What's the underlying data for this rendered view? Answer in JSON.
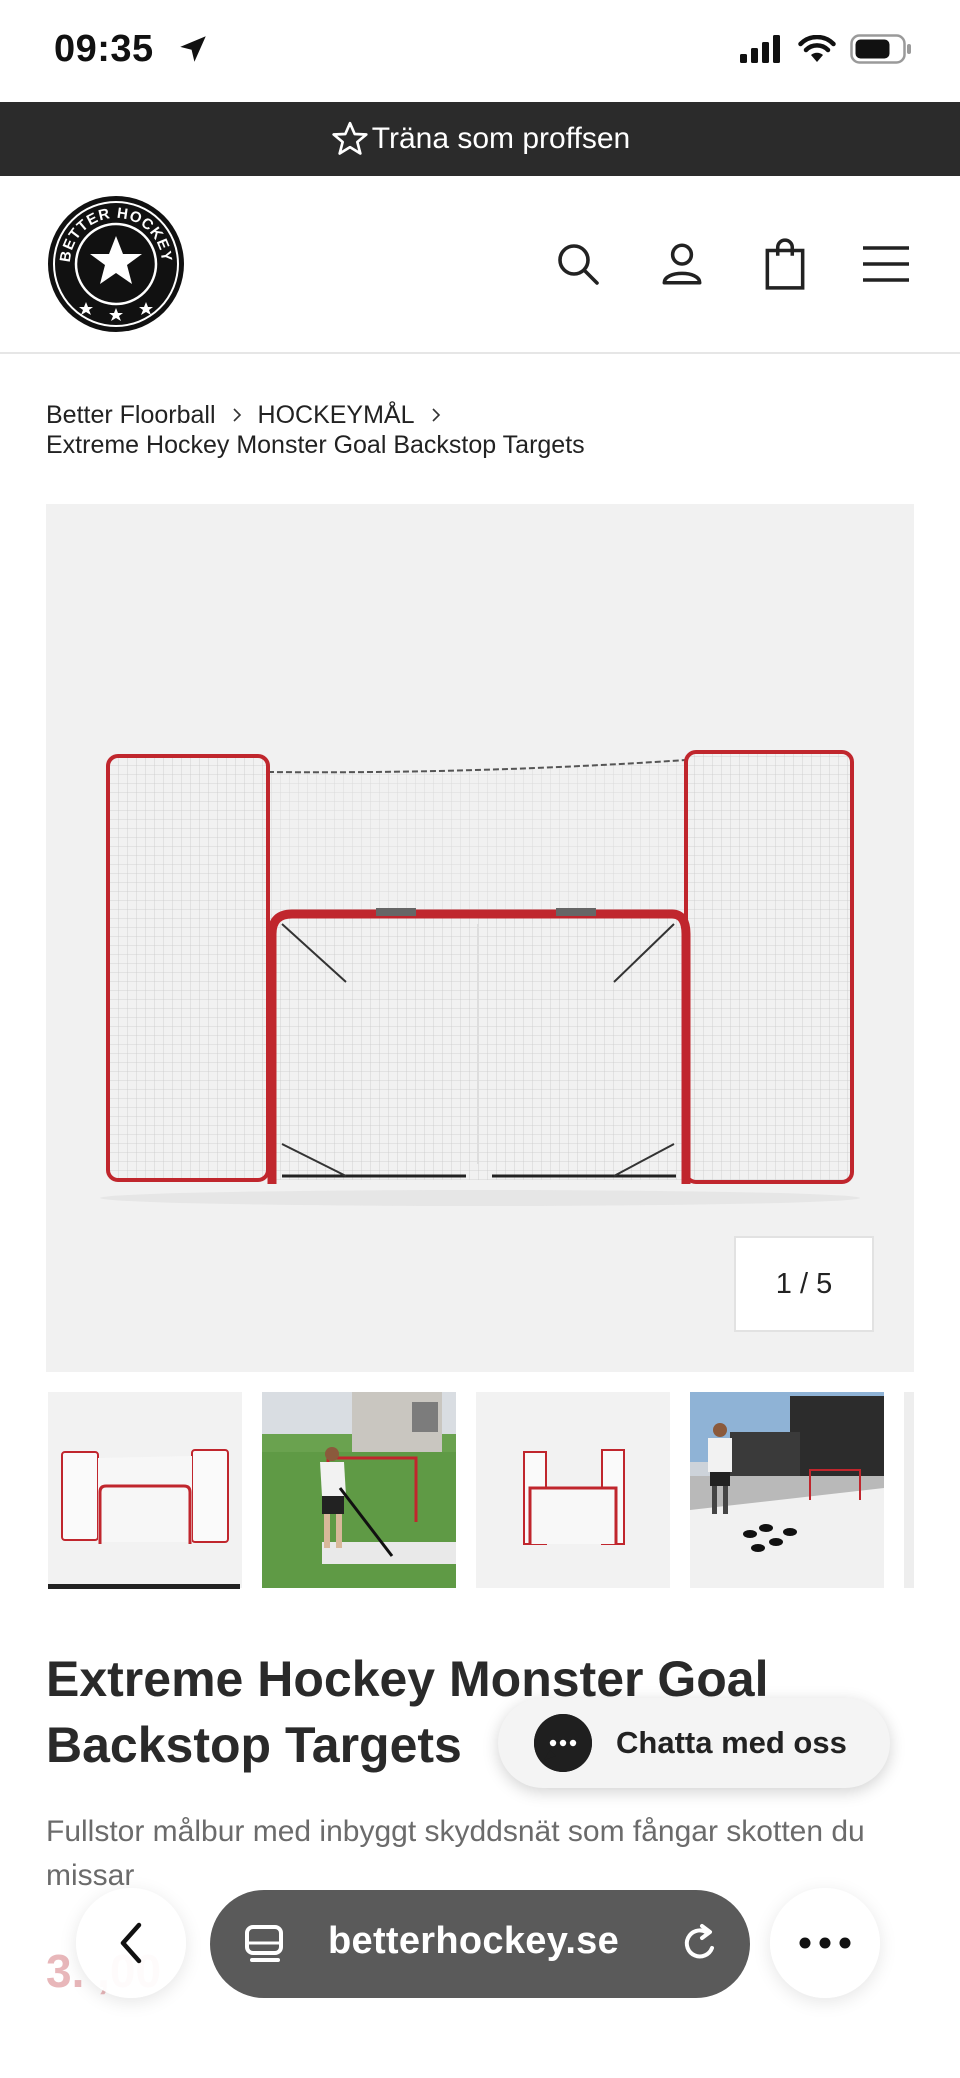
{
  "status_bar": {
    "time": "09:35"
  },
  "announcement": {
    "text": "Träna som proffsen"
  },
  "header": {
    "logo_text": "BETTER HOCKEY"
  },
  "breadcrumb": {
    "items": [
      "Better Floorball",
      "HOCKEYMÅL"
    ],
    "current": "Extreme Hockey Monster Goal Backstop Targets"
  },
  "gallery": {
    "counter": "1 / 5"
  },
  "product": {
    "title": "Extreme Hockey Monster Goal Backstop Targets",
    "subtitle": "Fullstor målbur med inbyggt skyddsnät som fångar skotten du missar",
    "price_partial": "3.  ,00"
  },
  "chat": {
    "label": "Chatta med oss"
  },
  "browser": {
    "url": "betterhockey.se"
  },
  "colors": {
    "announcement_bg": "#2b2b2b",
    "goal_red": "#c0262d",
    "price": "#e8b7ba",
    "url_pill": "#5a5a5a"
  }
}
